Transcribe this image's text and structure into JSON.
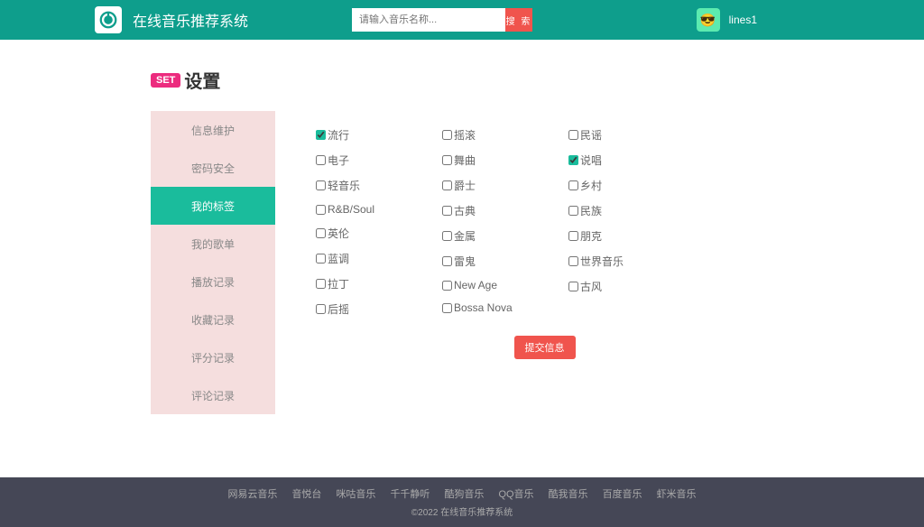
{
  "header": {
    "app_title": "在线音乐推荐系统",
    "search_placeholder": "请输入音乐名称...",
    "search_btn": "搜 索",
    "username": "lines1"
  },
  "page": {
    "badge": "SET",
    "title": "设置"
  },
  "sidebar": {
    "items": [
      {
        "label": "信息维护",
        "active": false
      },
      {
        "label": "密码安全",
        "active": false
      },
      {
        "label": "我的标签",
        "active": true
      },
      {
        "label": "我的歌单",
        "active": false
      },
      {
        "label": "播放记录",
        "active": false
      },
      {
        "label": "收藏记录",
        "active": false
      },
      {
        "label": "评分记录",
        "active": false
      },
      {
        "label": "评论记录",
        "active": false
      }
    ]
  },
  "tags": {
    "col1": [
      {
        "label": "流行",
        "checked": true
      },
      {
        "label": "电子",
        "checked": false
      },
      {
        "label": "轻音乐",
        "checked": false
      },
      {
        "label": "R&B/Soul",
        "checked": false
      },
      {
        "label": "英伦",
        "checked": false
      },
      {
        "label": "蓝调",
        "checked": false
      },
      {
        "label": "拉丁",
        "checked": false
      },
      {
        "label": "后摇",
        "checked": false
      }
    ],
    "col2": [
      {
        "label": "摇滚",
        "checked": false
      },
      {
        "label": "舞曲",
        "checked": false
      },
      {
        "label": "爵士",
        "checked": false
      },
      {
        "label": "古典",
        "checked": false
      },
      {
        "label": "金属",
        "checked": false
      },
      {
        "label": "雷鬼",
        "checked": false
      },
      {
        "label": "New Age",
        "checked": false
      },
      {
        "label": "Bossa Nova",
        "checked": false
      }
    ],
    "col3": [
      {
        "label": "民谣",
        "checked": false
      },
      {
        "label": "说唱",
        "checked": true
      },
      {
        "label": "乡村",
        "checked": false
      },
      {
        "label": "民族",
        "checked": false
      },
      {
        "label": "朋克",
        "checked": false
      },
      {
        "label": "世界音乐",
        "checked": false
      },
      {
        "label": "古风",
        "checked": false
      }
    ]
  },
  "submit_label": "提交信息",
  "footer": {
    "links": [
      "网易云音乐",
      "音悦台",
      "咪咕音乐",
      "千千静听",
      "酷狗音乐",
      "QQ音乐",
      "酷我音乐",
      "百度音乐",
      "虾米音乐"
    ],
    "copyright": "©2022 在线音乐推荐系统"
  }
}
